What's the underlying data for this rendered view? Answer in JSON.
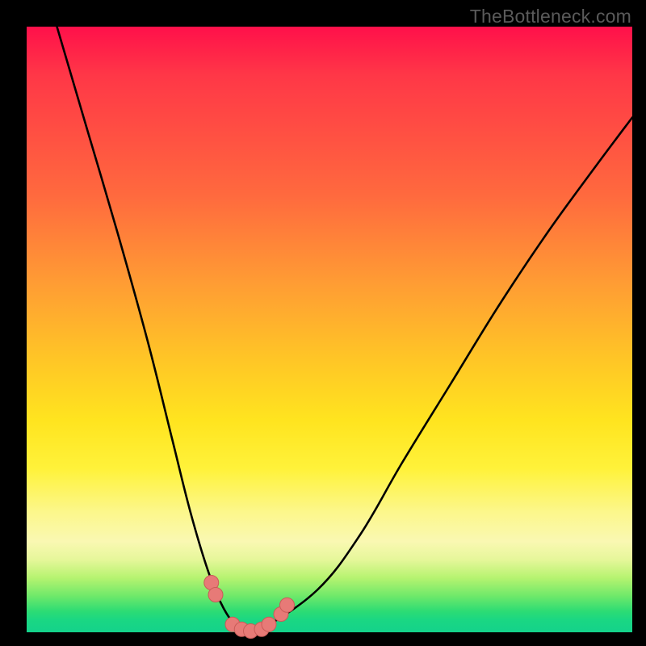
{
  "watermark": "TheBottleneck.com",
  "colors": {
    "frame": "#000000",
    "gradient_top": "#ff104a",
    "gradient_bottom": "#14d28b",
    "curve": "#000000",
    "marker_fill": "#e77a77",
    "marker_stroke": "#c95b58"
  },
  "chart_data": {
    "type": "line",
    "title": "",
    "xlabel": "",
    "ylabel": "",
    "xlim": [
      0,
      100
    ],
    "ylim": [
      0,
      100
    ],
    "grid": false,
    "legend": false,
    "series": [
      {
        "name": "bottleneck-curve",
        "x": [
          5,
          10,
          15,
          20,
          24,
          27,
          30,
          32.5,
          35,
          37,
          39,
          48,
          55,
          62,
          70,
          78,
          86,
          94,
          100
        ],
        "values": [
          100,
          83,
          66,
          48,
          32,
          20,
          10,
          4,
          0.6,
          0,
          0.6,
          7,
          16,
          28,
          41,
          54,
          66,
          77,
          85
        ]
      }
    ],
    "markers": {
      "name": "highlighted-points",
      "x": [
        30.5,
        31.2,
        34.0,
        35.5,
        37.0,
        38.8,
        40.0,
        42.0,
        43.0
      ],
      "values": [
        8.2,
        6.2,
        1.3,
        0.5,
        0.2,
        0.5,
        1.3,
        3.0,
        4.5
      ]
    }
  }
}
